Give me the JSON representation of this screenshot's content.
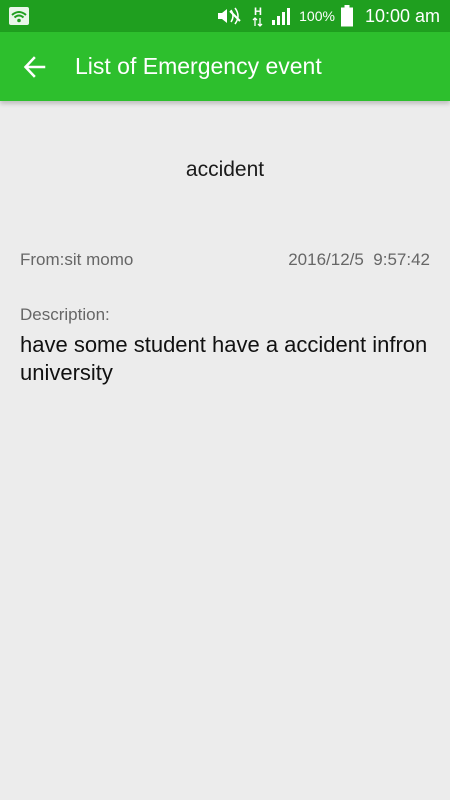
{
  "status_bar": {
    "battery_percent": "100%",
    "time": "10:00 am",
    "icons": [
      "wifi-icon",
      "mute-icon",
      "h-signal-icon",
      "signal-bars-icon",
      "battery-icon"
    ]
  },
  "app_bar": {
    "title": "List of Emergency event",
    "back_icon": "arrow-back-icon",
    "color": "#2dbf2d"
  },
  "event": {
    "title": "accident",
    "from": "From:sit momo",
    "datetime": "2016/12/5  9:57:42",
    "description_label": "Description:",
    "description": "have some student have a accident infron university"
  }
}
